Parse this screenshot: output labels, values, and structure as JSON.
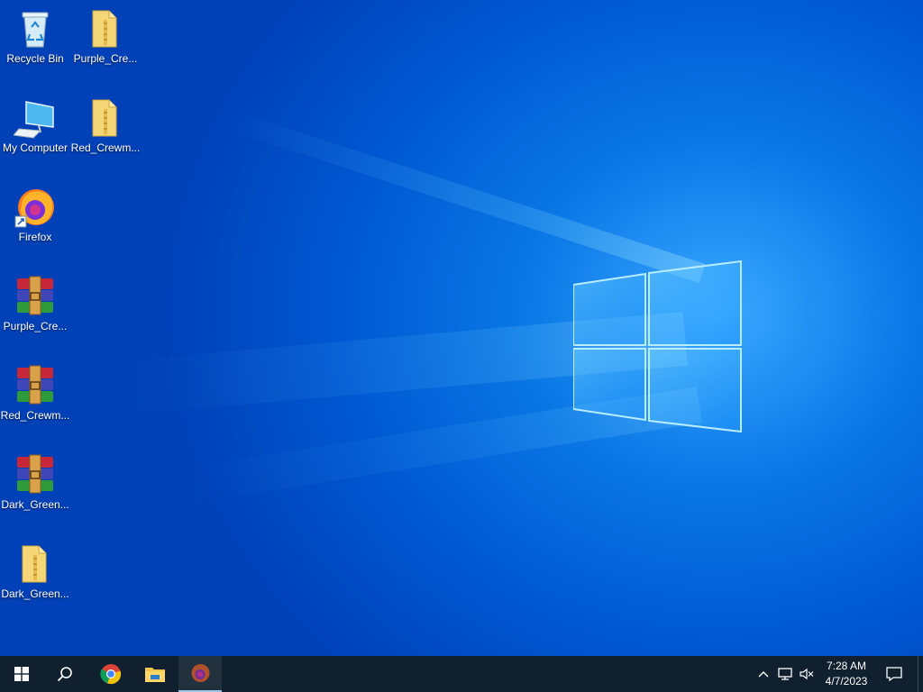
{
  "desktop": {
    "wallpaper_accent": "#0a78e6",
    "icons": [
      {
        "label": "Recycle Bin",
        "icon": "recycle-bin-icon"
      },
      {
        "label": "Purple_Cre...",
        "icon": "folder-icon"
      },
      {
        "label": "My Computer",
        "icon": "computer-icon"
      },
      {
        "label": "Red_Crewm...",
        "icon": "folder-icon"
      },
      {
        "label": "Firefox",
        "icon": "firefox-icon"
      },
      {
        "label": "Purple_Cre...",
        "icon": "winrar-archive-icon"
      },
      {
        "label": "Red_Crewm...",
        "icon": "winrar-archive-icon"
      },
      {
        "label": "Dark_Green...",
        "icon": "winrar-archive-icon"
      },
      {
        "label": "Dark_Green...",
        "icon": "folder-icon"
      }
    ]
  },
  "taskbar": {
    "background": "#10202e",
    "buttons": [
      {
        "name": "start",
        "icon": "windows-start-icon"
      },
      {
        "name": "search",
        "icon": "search-icon"
      },
      {
        "name": "chrome",
        "icon": "chrome-icon"
      },
      {
        "name": "file-explorer",
        "icon": "file-explorer-icon"
      },
      {
        "name": "firefox",
        "icon": "firefox-icon",
        "active": true
      }
    ],
    "tray": {
      "icons": [
        "chevron-up-icon",
        "network-icon",
        "volume-muted-icon",
        "notification-icon"
      ],
      "time": "7:28 AM",
      "date": "4/7/2023"
    }
  }
}
